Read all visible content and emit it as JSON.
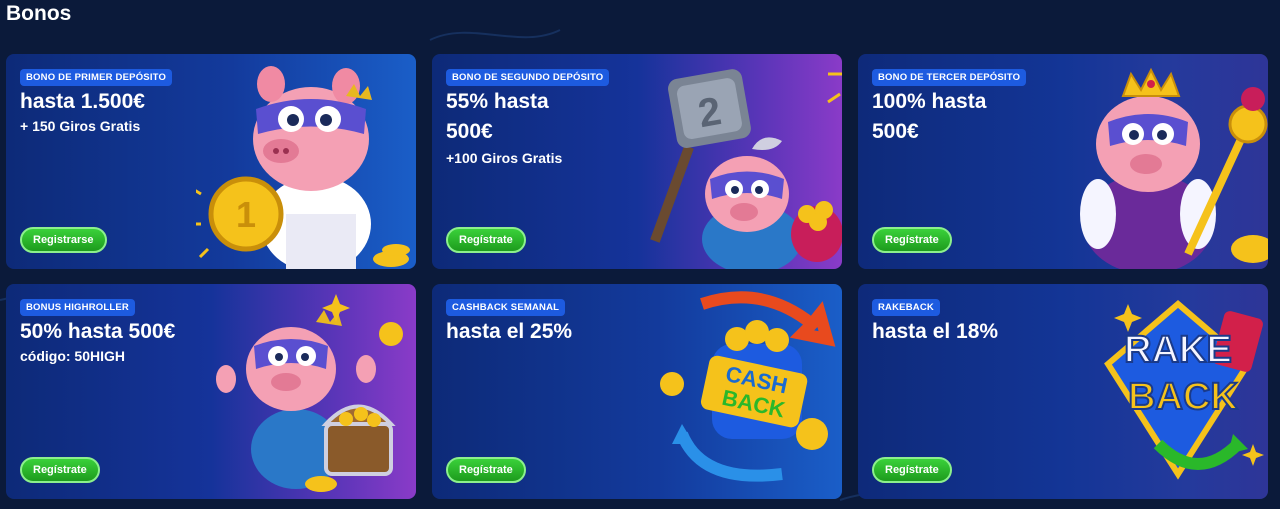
{
  "page": {
    "title": "Bonos"
  },
  "cards": [
    {
      "badge": "BONO DE PRIMER DEPÓSITO",
      "line1": "hasta 1.500€",
      "line2": "",
      "sub": "+ 150 Giros Gratis",
      "button": "Registrarse"
    },
    {
      "badge": "BONO DE SEGUNDO DEPÓSITO",
      "line1": "55% hasta",
      "line2": "500€",
      "sub": "+100 Giros Gratis",
      "button": "Regístrate"
    },
    {
      "badge": "BONO DE TERCER DEPÓSITO",
      "line1": "100% hasta",
      "line2": "500€",
      "sub": "",
      "button": "Regístrate"
    },
    {
      "badge": "BONUS HIGHROLLER",
      "line1": "50% hasta 500€",
      "line2": "",
      "sub": "código: 50HIGH",
      "button": "Regístrate"
    },
    {
      "badge": "CASHBACK SEMANAL",
      "line1": "hasta el 25%",
      "line2": "",
      "sub": "",
      "button": "Regístrate"
    },
    {
      "badge": "RAKEBACK",
      "line1": "hasta el 18%",
      "line2": "",
      "sub": "",
      "button": "Regístrate"
    }
  ],
  "art": {
    "cashback_text_1": "CASH",
    "cashback_text_2": "BACK",
    "rakeback_text_1": "RAKE",
    "rakeback_text_2": "BACK",
    "hammer_number": "2"
  },
  "colors": {
    "page_bg": "#0b1a3a",
    "badge_bg": "#1d5be0",
    "button_green": "#2bb82b",
    "pig_pink": "#f4a0b4",
    "gold": "#f5c21b"
  }
}
